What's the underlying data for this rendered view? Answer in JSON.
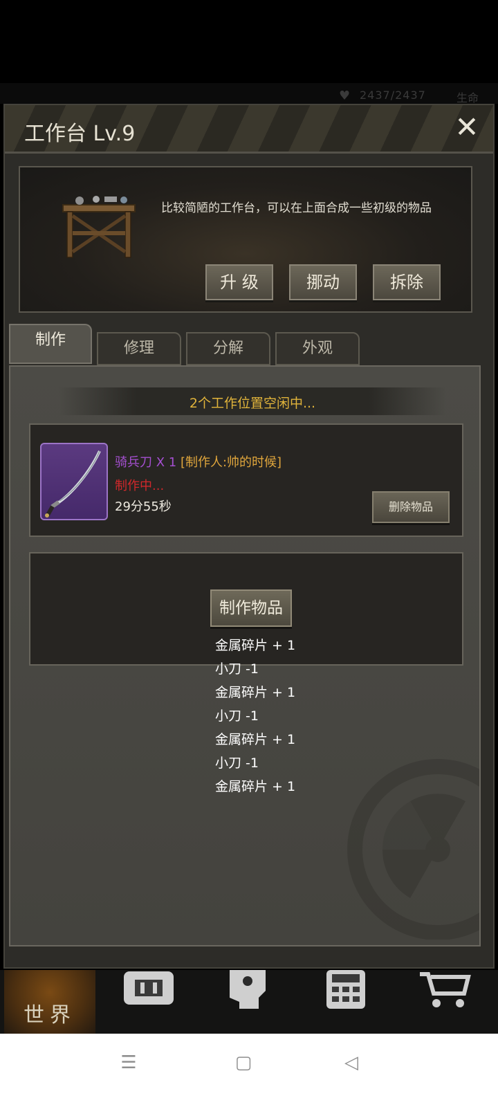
{
  "hud": {
    "hp": "2437/2437",
    "life_label": "生命"
  },
  "dialog": {
    "title": "工作台 Lv.9",
    "close": "✕",
    "description": "比较简陋的工作台，可以在上面合成一些初级的物品",
    "actions": {
      "upgrade": "升 级",
      "move": "挪动",
      "demolish": "拆除"
    }
  },
  "tabs": [
    "制作",
    "修理",
    "分解",
    "外观"
  ],
  "craft": {
    "slots_status": "2个工作位置空闲中...",
    "current": {
      "item_name": "骑兵刀 X 1",
      "maker": "[制作人:帅的时候]",
      "status": "制作中...",
      "time_left": "29分55秒",
      "delete_label": "删除物品"
    },
    "make_label": "制作物品"
  },
  "log": [
    "金属碎片 + 1",
    "小刀 -1",
    "金属碎片 + 1",
    "小刀 -1",
    "金属碎片 + 1",
    "小刀 -1",
    "金属碎片 + 1"
  ],
  "nav": {
    "world": "世界",
    "icons": [
      "backpack-icon",
      "skills-head-icon",
      "phone-icon",
      "cart-icon"
    ]
  },
  "system": {
    "menu": "☰",
    "home": "▢",
    "back": "◁"
  },
  "colors": {
    "accent_gold": "#e1b43b",
    "status_red": "#d1282b",
    "item_purple": "#a44fd0"
  }
}
